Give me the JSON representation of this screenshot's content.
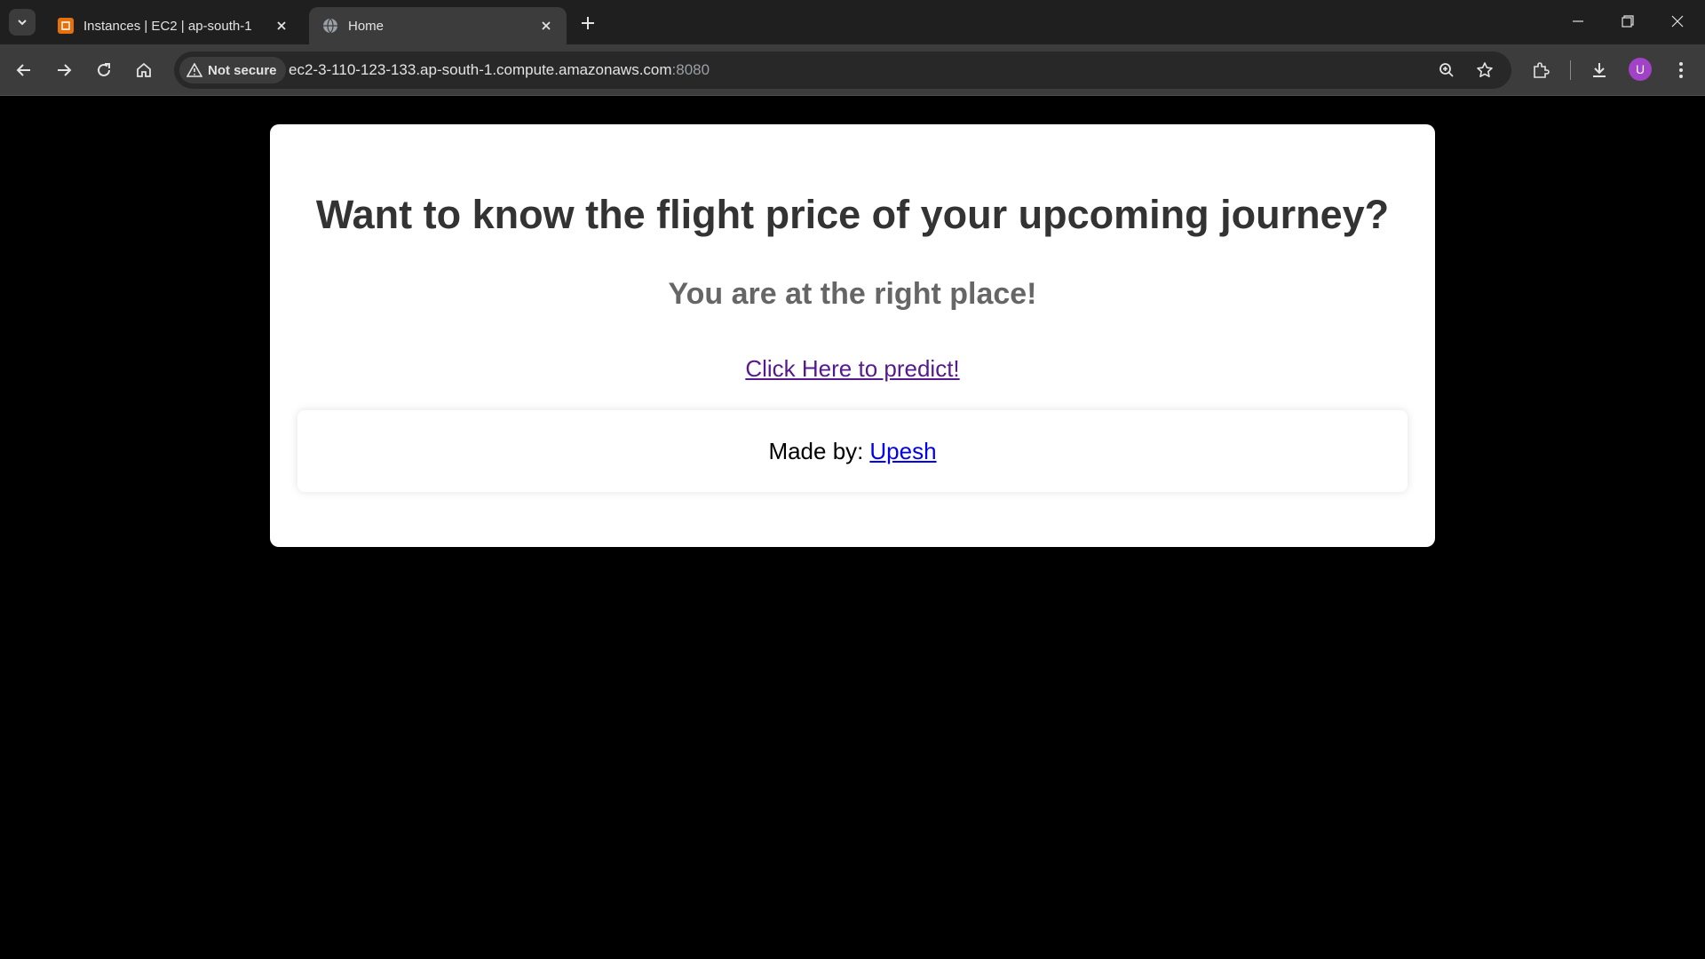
{
  "browser": {
    "tabs": [
      {
        "title": "Instances | EC2 | ap-south-1",
        "favicon": "aws-ec2-icon",
        "active": false
      },
      {
        "title": "Home",
        "favicon": "globe-icon",
        "active": true
      }
    ],
    "address_bar": {
      "security_label": "Not secure",
      "url_host": "ec2-3-110-123-133.ap-south-1.compute.amazonaws.com",
      "url_port": ":8080"
    },
    "profile_initial": "U",
    "profile_color": "#a142c7"
  },
  "page": {
    "heading": "Want to know the flight price of your upcoming journey?",
    "subheading": "You are at the right place!",
    "predict_link": "Click Here to predict!",
    "footer": {
      "made_by_label": "Made by:",
      "author_link": "Upesh"
    }
  },
  "colors": {
    "page_background": "#000000",
    "card_background": "#ffffff",
    "heading": "#333333",
    "subheading": "#666666",
    "visited_link": "#551a8b",
    "link": "#0000ee"
  }
}
